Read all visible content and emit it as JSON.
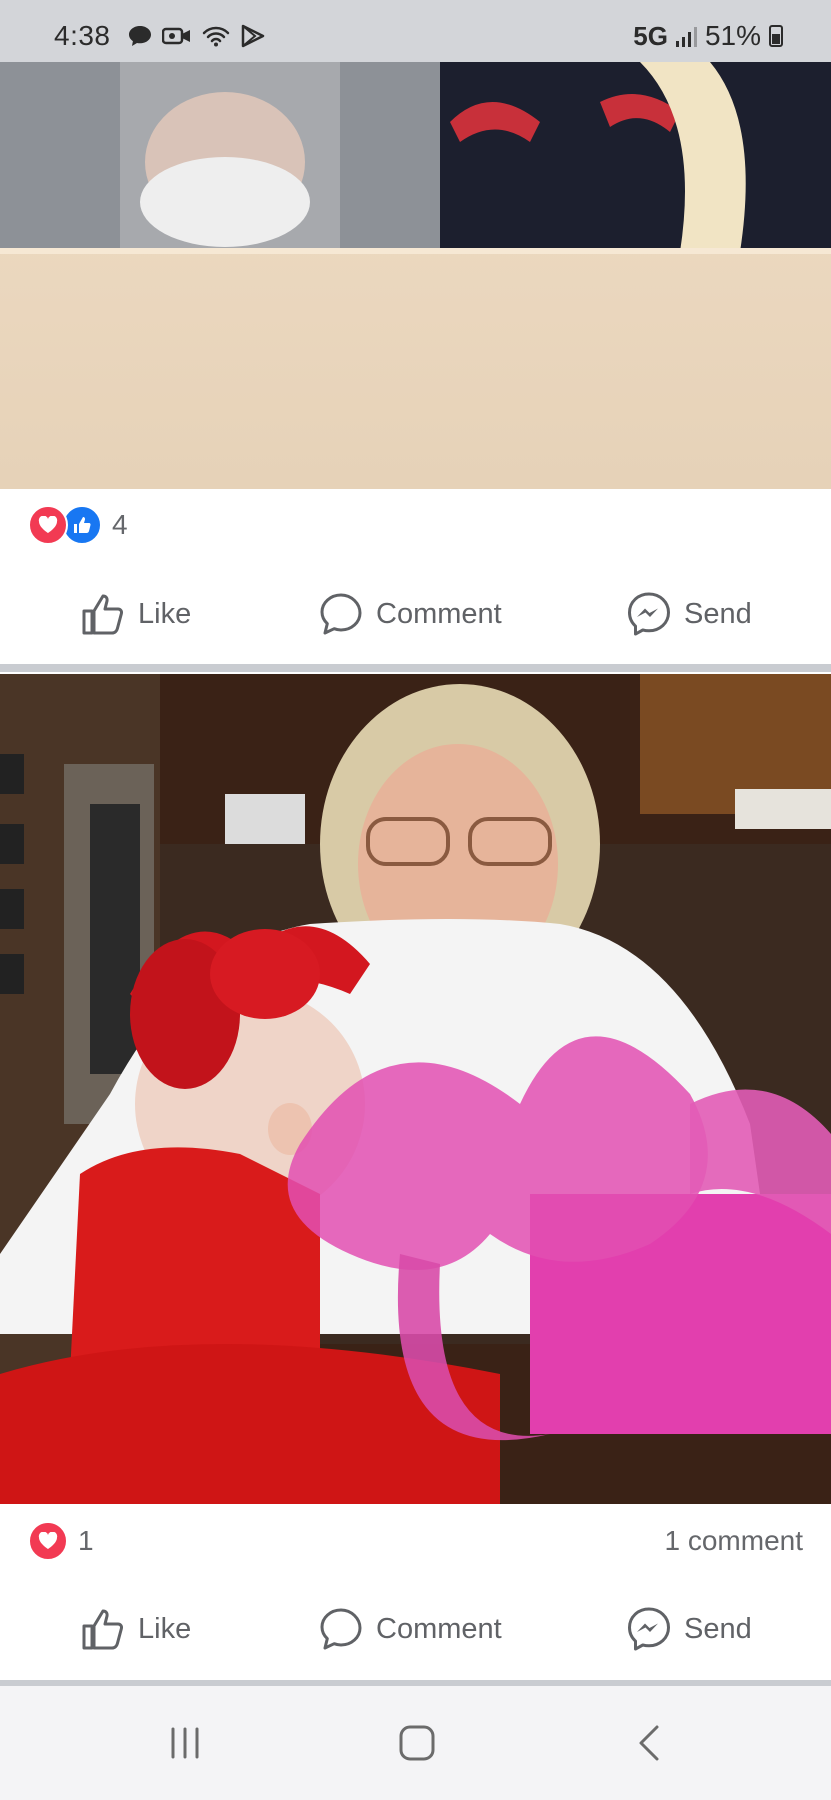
{
  "status_bar": {
    "time": "4:38",
    "network": "5G",
    "battery": "51%",
    "left_icons": [
      "chat-icon",
      "video-camera-icon",
      "wifi-icon",
      "play-store-icon"
    ]
  },
  "posts": [
    {
      "photo": {
        "description_icon": "photo"
      },
      "reactions": {
        "types": [
          "heart",
          "like"
        ],
        "count": "4"
      },
      "comment_count": "",
      "actions": {
        "like": "Like",
        "comment": "Comment",
        "send": "Send"
      }
    },
    {
      "photo": {
        "description_icon": "photo"
      },
      "reactions": {
        "types": [
          "heart"
        ],
        "count": "1"
      },
      "comment_count": "1 comment",
      "actions": {
        "like": "Like",
        "comment": "Comment",
        "send": "Send"
      }
    }
  ],
  "colors": {
    "heart": "#f23a53",
    "like": "#1877f2",
    "text_secondary": "#65676b",
    "divider": "#c9ccd1"
  },
  "nav": {
    "buttons": [
      "recent-apps",
      "home",
      "back"
    ]
  }
}
